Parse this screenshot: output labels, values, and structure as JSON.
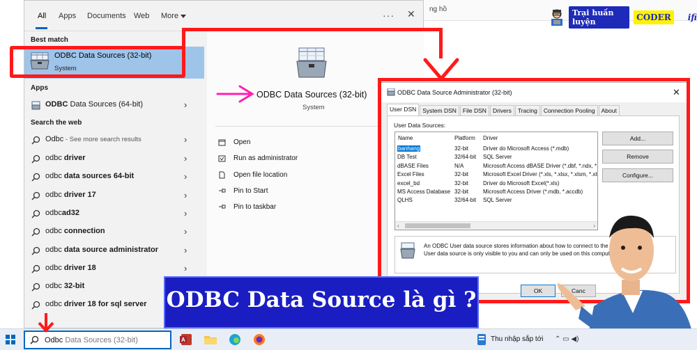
{
  "browser": {
    "tab_text": "ng hồ"
  },
  "brand": {
    "pill": "Trại huấn luyện",
    "coder": "CODER",
    "logo": "ifi"
  },
  "start_menu": {
    "tabs": [
      "All",
      "Apps",
      "Documents",
      "Web",
      "More"
    ],
    "best_match_header": "Best match",
    "best_match": {
      "title": "ODBC Data Sources (32-bit)",
      "subtitle": "System"
    },
    "apps_header": "Apps",
    "apps": [
      {
        "label_bold": "ODBC",
        "label_rest": " Data Sources (64-bit)"
      }
    ],
    "web_header": "Search the web",
    "web_first": {
      "term": "Odbc",
      "hint": " - See more search results"
    },
    "web_results": [
      {
        "pre": "odbc ",
        "bold": "driver"
      },
      {
        "pre": "odbc ",
        "bold": "data sources 64-bit"
      },
      {
        "pre": "odbc ",
        "bold": "driver 17"
      },
      {
        "pre": "odbc",
        "bold": "ad32"
      },
      {
        "pre": "odbc ",
        "bold": "connection"
      },
      {
        "pre": "odbc ",
        "bold": "data source administrator"
      },
      {
        "pre": "odbc ",
        "bold": "driver 18"
      },
      {
        "pre": "odbc ",
        "bold": "32-bit"
      },
      {
        "pre": "odbc ",
        "bold": "driver 18 for sql server"
      }
    ],
    "detail": {
      "title": "ODBC Data Sources (32-bit)",
      "subtitle": "System",
      "actions": [
        "Open",
        "Run as administrator",
        "Open file location",
        "Pin to Start",
        "Pin to taskbar"
      ]
    }
  },
  "dialog": {
    "title": "ODBC Data Source Administrator (32-bit)",
    "tabs": [
      "User DSN",
      "System DSN",
      "File DSN",
      "Drivers",
      "Tracing",
      "Connection Pooling",
      "About"
    ],
    "list_label": "User Data Sources:",
    "columns": [
      "Name",
      "Platform",
      "Driver"
    ],
    "rows": [
      {
        "name": "banhang",
        "platform": "32-bit",
        "driver": "Driver do Microsoft Access (*.mdb)"
      },
      {
        "name": "DB Test",
        "platform": "32/64-bit",
        "driver": "SQL Server"
      },
      {
        "name": "dBASE Files",
        "platform": "N/A",
        "driver": "Microsoft Access dBASE Driver (*.dbf, *.ndx, *.m"
      },
      {
        "name": "Excel Files",
        "platform": "32-bit",
        "driver": "Microsoft Excel Driver (*.xls, *.xlsx, *.xlsm, *.xlsb"
      },
      {
        "name": "excel_bd",
        "platform": "32-bit",
        "driver": "Driver do Microsoft Excel(*.xls)"
      },
      {
        "name": "MS Access Database",
        "platform": "32-bit",
        "driver": "Microsoft Access Driver (*.mdb, *.accdb)"
      },
      {
        "name": "QLHS",
        "platform": "32/64-bit",
        "driver": "SQL Server"
      }
    ],
    "buttons": {
      "add": "Add...",
      "remove": "Remove",
      "configure": "Configure..."
    },
    "info_line1": "An ODBC User data source stores information about how to connect to the indicat",
    "info_line2": "User data source is only visible to you and can only be used on this computer.",
    "ok": "OK",
    "cancel": "Canc"
  },
  "banner": {
    "text": "ODBC Data Source là gì ?"
  },
  "taskbar": {
    "search_typed": "Odbc",
    "search_ghost": " Data Sources (32-bit)",
    "news_text": "Thu nhập sắp tới"
  },
  "colors": {
    "annotation_red": "#ff1a1a",
    "banner_blue": "#1a1ec2",
    "selection_blue": "#9fc4ea",
    "accent": "#0067c0"
  }
}
